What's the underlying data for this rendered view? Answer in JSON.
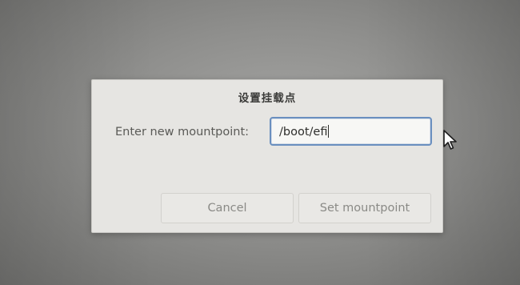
{
  "dialog": {
    "title": "设置挂载点",
    "label": "Enter new mountpoint:",
    "field_value": "/boot/efi",
    "buttons": {
      "cancel": "Cancel",
      "set": "Set mountpoint"
    }
  },
  "colors": {
    "dialog_bg": "#e6e5e2",
    "field_border": "#6a8fbf",
    "desktop": "#8f8f8d"
  },
  "icons": {
    "pointer": "mouse-pointer-icon"
  }
}
